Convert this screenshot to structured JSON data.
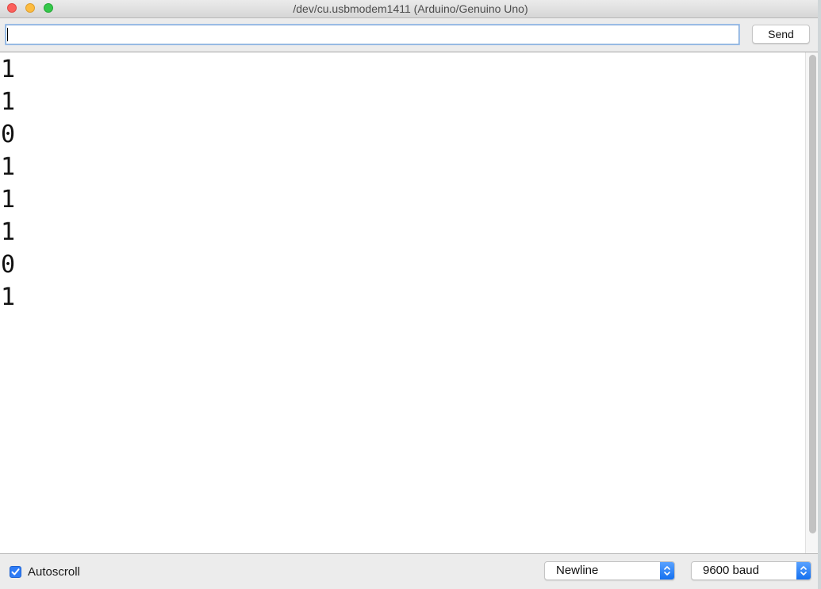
{
  "window": {
    "title": "/dev/cu.usbmodem1411 (Arduino/Genuino Uno)"
  },
  "toolbar": {
    "input_value": "",
    "send_label": "Send"
  },
  "output": {
    "lines": [
      "1",
      "1",
      "0",
      "1",
      "1",
      "1",
      "0",
      "1"
    ]
  },
  "statusbar": {
    "autoscroll_label": "Autoscroll",
    "autoscroll_checked": true,
    "line_ending_selected": "Newline",
    "baud_selected": "9600 baud"
  },
  "colors": {
    "accent": "#2f7cf6",
    "close": "#fc605c",
    "minimize": "#fdbc40",
    "zoom": "#34c84a"
  },
  "icons": {
    "checkbox": "checkmark-icon",
    "select_arrows": "updown-chevron-icon"
  }
}
